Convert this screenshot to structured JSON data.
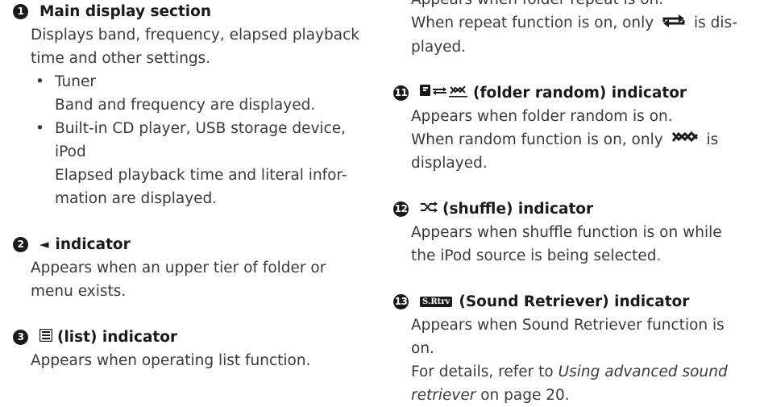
{
  "left": {
    "s1": {
      "num": "1",
      "title": "Main display section",
      "desc_1": "Displays band, frequency, elapsed playback",
      "desc_2": "time and other settings.",
      "bullets": [
        {
          "l1": "Tuner",
          "l2": "Band and frequency are displayed."
        },
        {
          "l1": "Built-in CD player, USB storage device,",
          "l2": "iPod"
        }
      ],
      "detail_1": "Elapsed playback time and literal infor-",
      "detail_2": "mation are displayed."
    },
    "s2": {
      "num": "2",
      "title_glyph": "◄",
      "title": "indicator",
      "desc_1": "Appears when an upper tier of folder or",
      "desc_2": "menu exists."
    },
    "s3": {
      "num": "3",
      "title": "(list) indicator",
      "icon": "list-icon",
      "desc": "Appears when operating list function."
    }
  },
  "right": {
    "top": {
      "line_1": "Appears when folder repeat is on.",
      "line_2a": "When repeat function is on, only",
      "line_2b": "is dis-",
      "line_3": "played.",
      "icon": "repeat-icon"
    },
    "s11": {
      "num": "11",
      "title": "(folder random) indicator",
      "icon": "folder-random-icon",
      "desc_1": "Appears when folder random is on.",
      "desc_2a": "When random function is on, only",
      "desc_2b": "is",
      "desc_3": "displayed.",
      "inline_icon": "random-icon"
    },
    "s12": {
      "num": "12",
      "title": "(shuffle) indicator",
      "icon": "shuffle-icon",
      "desc_1": "Appears when shuffle function is on while",
      "desc_2": "the iPod source is being selected."
    },
    "s13": {
      "num": "13",
      "badge": "S.Rtrv",
      "title": "(Sound Retriever) indicator",
      "desc_1": "Appears when Sound Retriever function is",
      "desc_2": "on.",
      "desc_3a": "For details, refer to",
      "desc_3b": "Using advanced sound",
      "desc_4a": "retriever",
      "desc_4b": "on page 20."
    }
  }
}
